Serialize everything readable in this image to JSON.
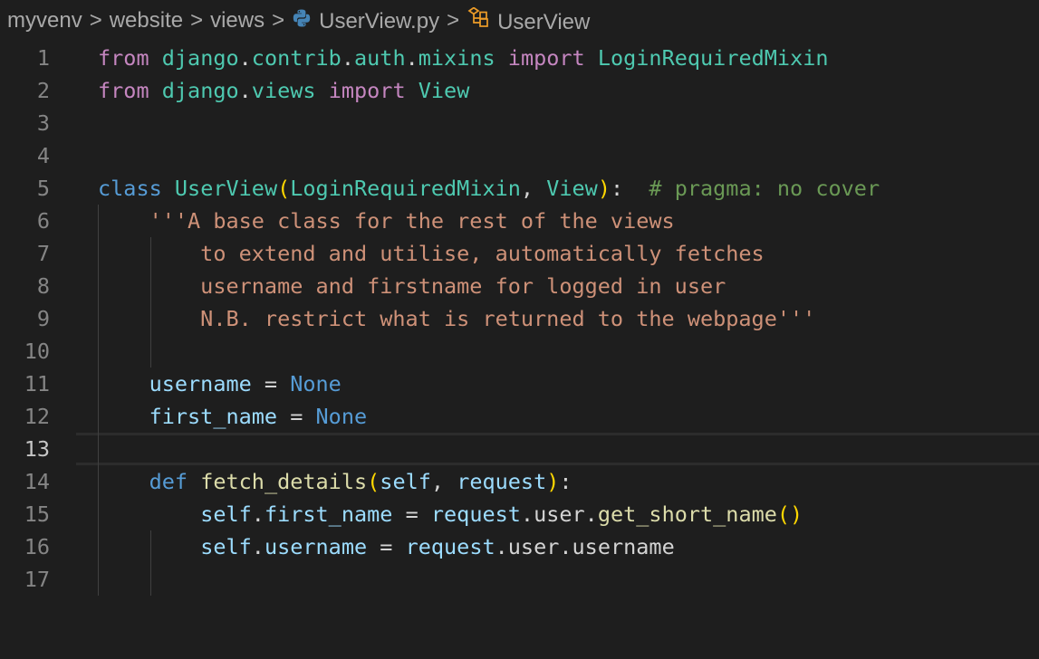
{
  "breadcrumbs": {
    "items": [
      "myvenv",
      "website",
      "views",
      "UserView.py",
      "UserView"
    ],
    "separator": ">"
  },
  "editor": {
    "current_line": 13,
    "line_numbers": [
      "1",
      "2",
      "3",
      "4",
      "5",
      "6",
      "7",
      "8",
      "9",
      "10",
      "11",
      "12",
      "13",
      "14",
      "15",
      "16",
      "17"
    ],
    "lines": [
      [
        [
          "kw-import",
          "from"
        ],
        [
          "punc",
          " "
        ],
        [
          "cls",
          "django"
        ],
        [
          "punc",
          "."
        ],
        [
          "cls",
          "contrib"
        ],
        [
          "punc",
          "."
        ],
        [
          "cls",
          "auth"
        ],
        [
          "punc",
          "."
        ],
        [
          "cls",
          "mixins"
        ],
        [
          "punc",
          " "
        ],
        [
          "kw-import",
          "import"
        ],
        [
          "punc",
          " "
        ],
        [
          "cls",
          "LoginRequiredMixin"
        ]
      ],
      [
        [
          "kw-import",
          "from"
        ],
        [
          "punc",
          " "
        ],
        [
          "cls",
          "django"
        ],
        [
          "punc",
          "."
        ],
        [
          "cls",
          "views"
        ],
        [
          "punc",
          " "
        ],
        [
          "kw-import",
          "import"
        ],
        [
          "punc",
          " "
        ],
        [
          "cls",
          "View"
        ]
      ],
      [],
      [],
      [
        [
          "kw",
          "class"
        ],
        [
          "punc",
          " "
        ],
        [
          "cls",
          "UserView"
        ],
        [
          "br1",
          "("
        ],
        [
          "cls",
          "LoginRequiredMixin"
        ],
        [
          "punc",
          ", "
        ],
        [
          "cls",
          "View"
        ],
        [
          "br1",
          ")"
        ],
        [
          "punc",
          ":  "
        ],
        [
          "cmt",
          "# pragma: no cover"
        ]
      ],
      [
        [
          "punc",
          "    "
        ],
        [
          "str",
          "'''A base class for the rest of the views"
        ]
      ],
      [
        [
          "str",
          "        to extend and utilise, automatically fetches"
        ]
      ],
      [
        [
          "str",
          "        username and firstname for logged in user"
        ]
      ],
      [
        [
          "str",
          "        N.B. restrict what is returned to the webpage'''"
        ]
      ],
      [],
      [
        [
          "punc",
          "    "
        ],
        [
          "ident",
          "username"
        ],
        [
          "punc",
          " = "
        ],
        [
          "kw",
          "None"
        ]
      ],
      [
        [
          "punc",
          "    "
        ],
        [
          "ident",
          "first_name"
        ],
        [
          "punc",
          " = "
        ],
        [
          "kw",
          "None"
        ]
      ],
      [],
      [
        [
          "punc",
          "    "
        ],
        [
          "kw",
          "def"
        ],
        [
          "punc",
          " "
        ],
        [
          "fn",
          "fetch_details"
        ],
        [
          "br1",
          "("
        ],
        [
          "ident",
          "self"
        ],
        [
          "punc",
          ", "
        ],
        [
          "ident",
          "request"
        ],
        [
          "br1",
          ")"
        ],
        [
          "punc",
          ":"
        ]
      ],
      [
        [
          "punc",
          "        "
        ],
        [
          "ident",
          "self"
        ],
        [
          "punc",
          "."
        ],
        [
          "ident",
          "first_name"
        ],
        [
          "punc",
          " = "
        ],
        [
          "ident",
          "request"
        ],
        [
          "punc",
          "."
        ],
        [
          "punc",
          "user"
        ],
        [
          "punc",
          "."
        ],
        [
          "fn",
          "get_short_name"
        ],
        [
          "br1",
          "()"
        ]
      ],
      [
        [
          "punc",
          "        "
        ],
        [
          "ident",
          "self"
        ],
        [
          "punc",
          "."
        ],
        [
          "ident",
          "username"
        ],
        [
          "punc",
          " = "
        ],
        [
          "ident",
          "request"
        ],
        [
          "punc",
          "."
        ],
        [
          "punc",
          "user"
        ],
        [
          "punc",
          "."
        ],
        [
          "punc",
          "username"
        ]
      ],
      []
    ]
  },
  "icons": {
    "python_file": "python-icon",
    "class_symbol": "class-symbol-icon"
  },
  "colors": {
    "background": "#1e1e1e",
    "keyword": "#569cd6",
    "import_keyword": "#c586c0",
    "class_name": "#4ec9b0",
    "function": "#dcdcaa",
    "string": "#ce9178",
    "comment": "#6a9955",
    "identifier": "#9cdcfe"
  }
}
